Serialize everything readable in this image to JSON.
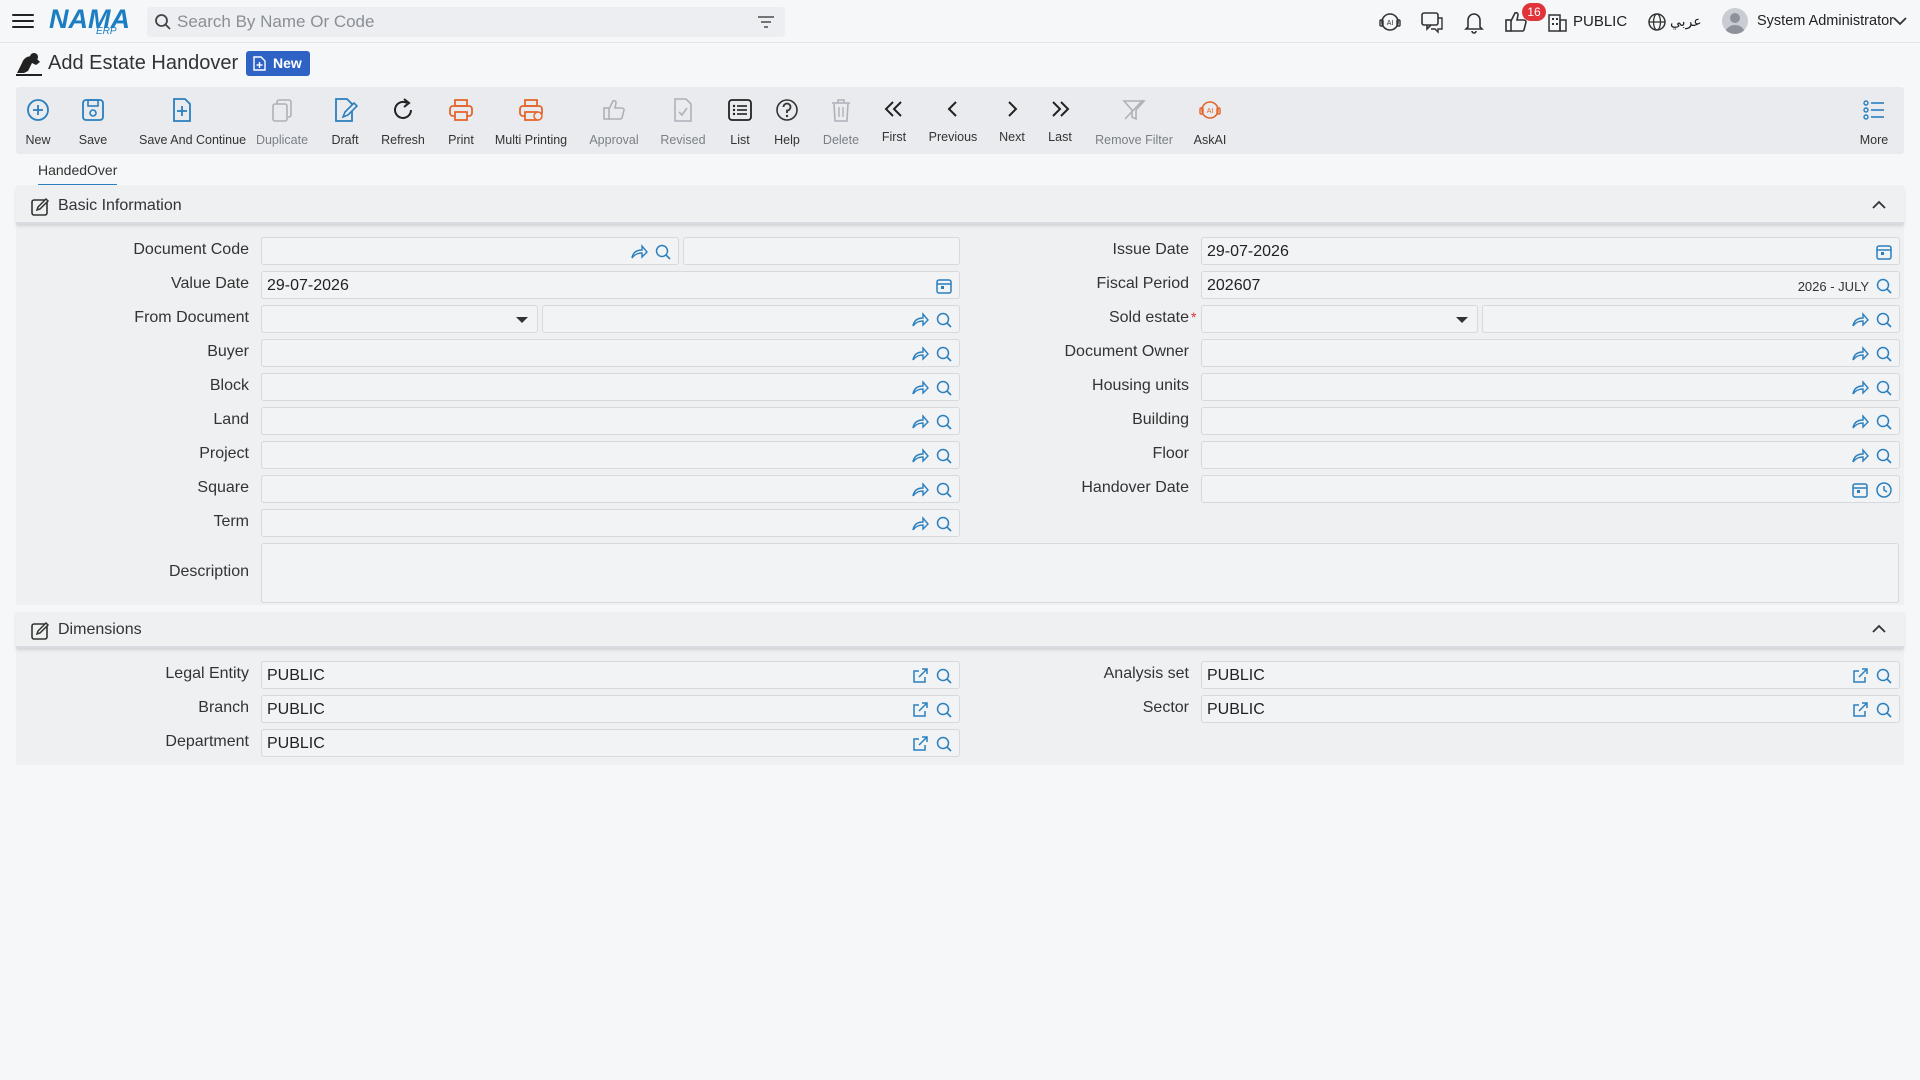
{
  "app": {
    "logo_text": "NAMA",
    "logo_sub": "ERP",
    "search_placeholder": "Search By Name Or Code",
    "notification_count": "16",
    "entity": "PUBLIC",
    "language": "عربي",
    "user": "System Administrator"
  },
  "page": {
    "title": "Add Estate Handover",
    "status_badge": "New"
  },
  "toolbar": [
    {
      "label": "New",
      "icon": "plus-circle-icon"
    },
    {
      "label": "Save",
      "icon": "save-icon"
    },
    {
      "label": "Save And Continue",
      "icon": "save-continue-icon"
    },
    {
      "label": "Duplicate",
      "icon": "duplicate-icon"
    },
    {
      "label": "Draft",
      "icon": "draft-icon"
    },
    {
      "label": "Refresh",
      "icon": "refresh-icon"
    },
    {
      "label": "Print",
      "icon": "print-icon"
    },
    {
      "label": "Multi Printing",
      "icon": "multi-print-icon"
    },
    {
      "label": "Approval",
      "icon": "thumbs-up-icon"
    },
    {
      "label": "Revised",
      "icon": "revised-icon"
    },
    {
      "label": "List",
      "icon": "list-icon"
    },
    {
      "label": "Help",
      "icon": "help-icon"
    },
    {
      "label": "Delete",
      "icon": "trash-icon"
    },
    {
      "label": "First",
      "icon": "double-chevron-left-icon"
    },
    {
      "label": "Previous",
      "icon": "chevron-left-icon"
    },
    {
      "label": "Next",
      "icon": "chevron-right-icon"
    },
    {
      "label": "Last",
      "icon": "double-chevron-right-icon"
    },
    {
      "label": "Remove Filter",
      "icon": "filter-off-icon"
    },
    {
      "label": "AskAI",
      "icon": "ai-icon"
    },
    {
      "label": "More",
      "icon": "more-list-icon"
    }
  ],
  "tabs": [
    {
      "label": "HandedOver"
    }
  ],
  "basic": {
    "title": "Basic Information",
    "document_code": {
      "label": "Document Code",
      "value": "",
      "value2": ""
    },
    "issue_date": {
      "label": "Issue Date",
      "value": "29-07-2026"
    },
    "value_date": {
      "label": "Value Date",
      "value": "29-07-2026"
    },
    "fiscal_period": {
      "label": "Fiscal Period",
      "value": "202607",
      "period_name": "2026 - JULY"
    },
    "from_document": {
      "label": "From Document",
      "value": ""
    },
    "sold_estate": {
      "label": "Sold estate",
      "required_mark": "*",
      "value": ""
    },
    "buyer": {
      "label": "Buyer",
      "value": ""
    },
    "document_owner": {
      "label": "Document Owner",
      "value": ""
    },
    "block": {
      "label": "Block",
      "value": ""
    },
    "housing_units": {
      "label": "Housing units",
      "value": ""
    },
    "land": {
      "label": "Land",
      "value": ""
    },
    "building": {
      "label": "Building",
      "value": ""
    },
    "project": {
      "label": "Project",
      "value": ""
    },
    "floor": {
      "label": "Floor",
      "value": ""
    },
    "square": {
      "label": "Square",
      "value": ""
    },
    "handover_date": {
      "label": "Handover Date",
      "value": ""
    },
    "term": {
      "label": "Term",
      "value": ""
    },
    "description": {
      "label": "Description",
      "value": ""
    }
  },
  "dimensions": {
    "title": "Dimensions",
    "legal_entity": {
      "label": "Legal Entity",
      "value": "PUBLIC"
    },
    "analysis_set": {
      "label": "Analysis set",
      "value": "PUBLIC"
    },
    "branch": {
      "label": "Branch",
      "value": "PUBLIC"
    },
    "sector": {
      "label": "Sector",
      "value": "PUBLIC"
    },
    "department": {
      "label": "Department",
      "value": "PUBLIC"
    }
  },
  "colors": {
    "accent": "#2a7fbf",
    "print": "#e4662c",
    "badge": "#2e63c5",
    "alert": "#e0343a"
  }
}
